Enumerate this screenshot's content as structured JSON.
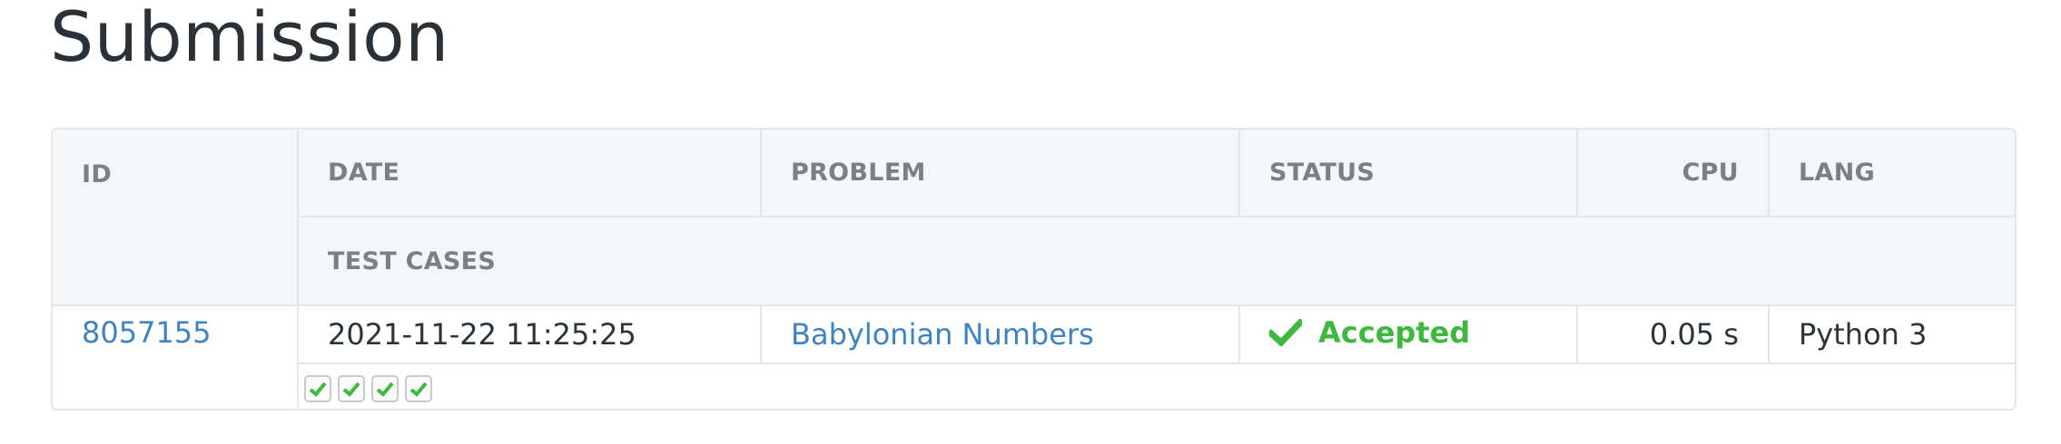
{
  "page": {
    "title": "Submission"
  },
  "table": {
    "headers": {
      "id": "ID",
      "date": "DATE",
      "problem": "PROBLEM",
      "status": "STATUS",
      "cpu": "CPU",
      "lang": "LANG",
      "test_cases": "TEST CASES"
    },
    "rows": [
      {
        "id": "8057155",
        "date": "2021-11-22 11:25:25",
        "problem": "Babylonian Numbers",
        "status": "Accepted",
        "status_icon": "check-icon",
        "cpu": "0.05 s",
        "lang": "Python 3",
        "test_cases": [
          {
            "result": "accepted",
            "icon": "check-icon"
          },
          {
            "result": "accepted",
            "icon": "check-icon"
          },
          {
            "result": "accepted",
            "icon": "check-icon"
          },
          {
            "result": "accepted",
            "icon": "check-icon"
          }
        ]
      }
    ]
  },
  "colors": {
    "accepted": "#3dba3d",
    "link": "#3f84c2",
    "header_bg": "#f5f6f8",
    "border": "#e3e6ea"
  }
}
